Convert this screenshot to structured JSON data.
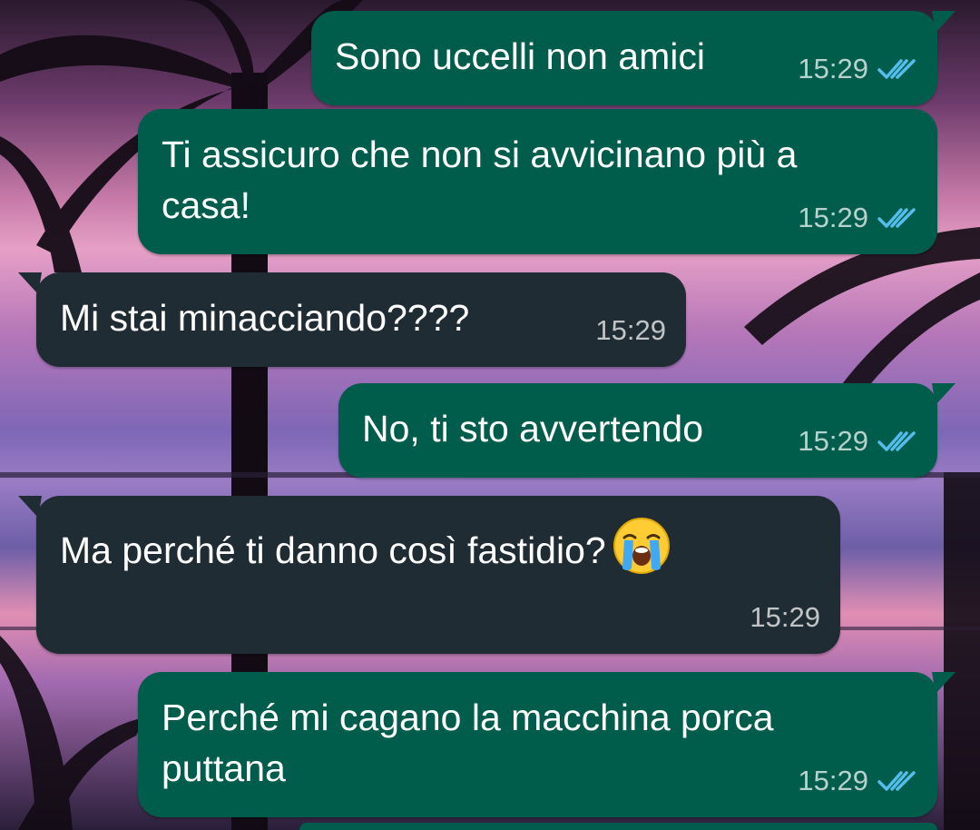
{
  "conversation": {
    "messages": [
      {
        "direction": "outgoing",
        "text": "Sono uccelli non amici",
        "time": "15:29",
        "status": "read"
      },
      {
        "direction": "outgoing",
        "text": "Ti assicuro che non si avvicinano più a\ncasa!",
        "time": "15:29",
        "status": "read"
      },
      {
        "direction": "incoming",
        "text": "Mi stai minacciando????",
        "time": "15:29"
      },
      {
        "direction": "outgoing",
        "text": "No, ti sto avvertendo",
        "time": "15:29",
        "status": "read"
      },
      {
        "direction": "incoming",
        "text": "Ma perché ti danno così fastidio?",
        "time": "15:29",
        "emoji": "loudly-crying-face"
      },
      {
        "direction": "outgoing",
        "text": "Perché mi cagano la macchina porca\nputtana",
        "time": "15:29",
        "status": "read"
      }
    ]
  },
  "colors": {
    "outgoing_bubble": "#005c4b",
    "incoming_bubble": "#202c33",
    "read_check": "#53bdeb"
  },
  "icons": {
    "read_receipt": "double-check-icon",
    "emoji": "loudly-crying-face-emoji"
  }
}
